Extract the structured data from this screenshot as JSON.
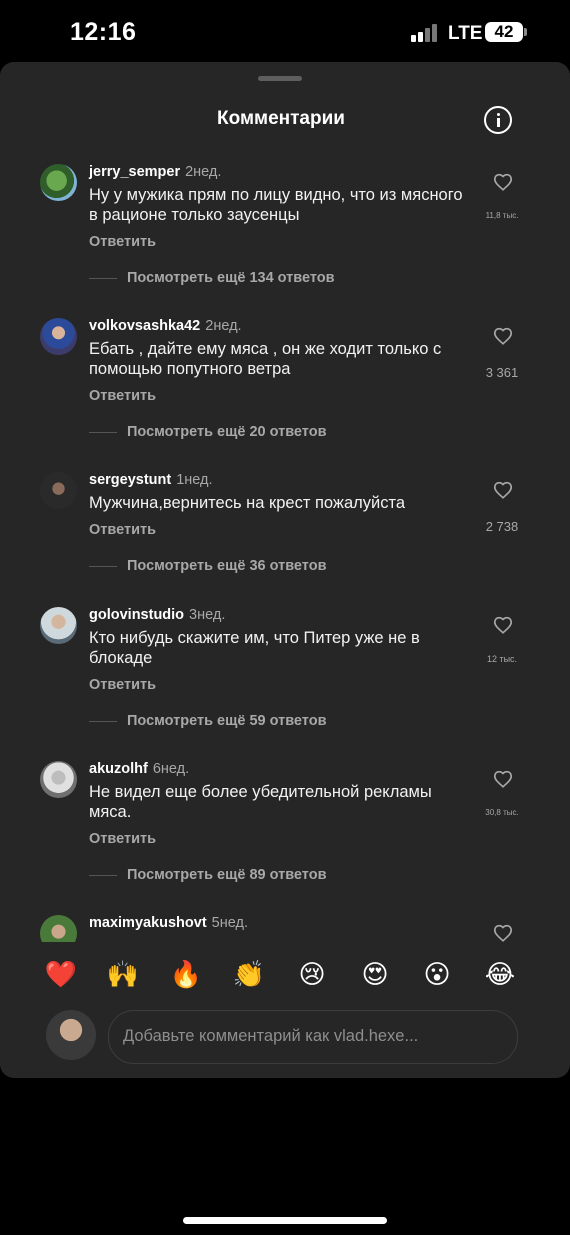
{
  "status": {
    "time": "12:16",
    "network": "LTE",
    "battery": "42"
  },
  "sheet": {
    "title": "Комментарии"
  },
  "comments": [
    {
      "user": "jerry_semper",
      "age": "2нед.",
      "text": "Ну у мужика прям по лицу видно, что из мясного в рационе только заусенцы",
      "reply": "Ответить",
      "more": "Посмотреть ещё 134 ответов",
      "likes": "11,8 тыс."
    },
    {
      "user": "volkovsashka42",
      "age": "2нед.",
      "text": "Ебать , дайте ему мяса , он же ходит только с помощью попутного ветра",
      "reply": "Ответить",
      "more": "Посмотреть ещё 20 ответов",
      "likes": "3 361"
    },
    {
      "user": "sergeystunt",
      "age": "1нед.",
      "text": "Мужчина,вернитесь на крест пожалуйста",
      "reply": "Ответить",
      "more": "Посмотреть ещё 36 ответов",
      "likes": "2 738"
    },
    {
      "user": "golovinstudio",
      "age": "3нед.",
      "text": "Кто нибудь скажите им, что Питер уже не в блокаде",
      "reply": "Ответить",
      "more": "Посмотреть ещё 59 ответов",
      "likes": "12 тыс."
    },
    {
      "user": "akuzolhf",
      "age": "6нед.",
      "text": "Не видел еще более убедительной рекламы мяса.",
      "reply": "Ответить",
      "more": "Посмотреть ещё 89 ответов",
      "likes": "30,8 тыс."
    },
    {
      "user": "maximyakushovt",
      "age": "5нед.",
      "text": "",
      "reply": "",
      "more": "",
      "likes": ""
    }
  ],
  "emojis": [
    "❤️",
    "🙌",
    "🔥",
    "👏",
    "😢",
    "😍",
    "😮",
    "😂"
  ],
  "compose": {
    "placeholder": "Добавьте комментарий как vlad.hexe..."
  },
  "colors": {
    "background": "#000000",
    "sheet": "#262626",
    "secondary_text": "#a8a8a8"
  }
}
